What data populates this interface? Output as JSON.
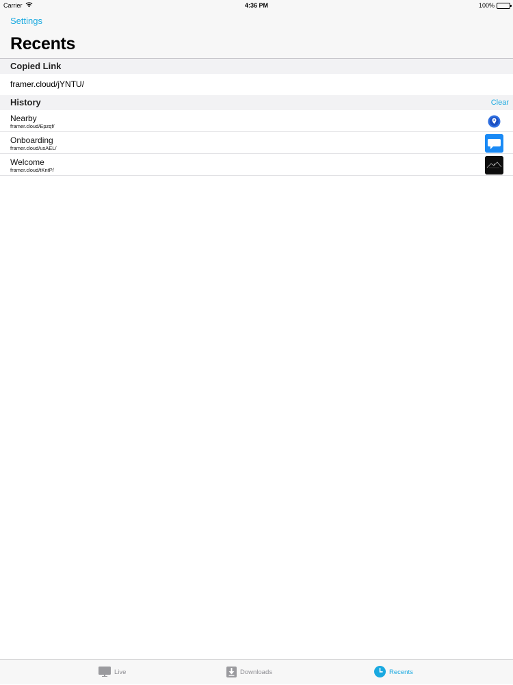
{
  "status_bar": {
    "carrier": "Carrier",
    "time": "4:36 PM",
    "battery": "100%"
  },
  "nav": {
    "settings_label": "Settings",
    "title": "Recents"
  },
  "copied_link": {
    "header": "Copied Link",
    "url": "framer.cloud/jYNTU/"
  },
  "history": {
    "header": "History",
    "clear_label": "Clear",
    "items": [
      {
        "title": "Nearby",
        "url": "framer.cloud/Epzqf/",
        "thumb_icon": "location-pin-icon"
      },
      {
        "title": "Onboarding",
        "url": "framer.cloud/usAEL/",
        "thumb_icon": "chat-bubble-icon"
      },
      {
        "title": "Welcome",
        "url": "framer.cloud/tKntP/",
        "thumb_icon": "dark-landscape-icon"
      }
    ]
  },
  "tab_bar": {
    "tabs": [
      {
        "label": "Live",
        "icon": "monitor-icon",
        "active": false
      },
      {
        "label": "Downloads",
        "icon": "download-icon",
        "active": false
      },
      {
        "label": "Recents",
        "icon": "clock-icon",
        "active": true
      }
    ]
  },
  "colors": {
    "accent": "#1aa9e0",
    "inactive_tab": "#8e8e93",
    "header_bg": "#f7f7f7",
    "section_bg": "#f2f2f4"
  }
}
